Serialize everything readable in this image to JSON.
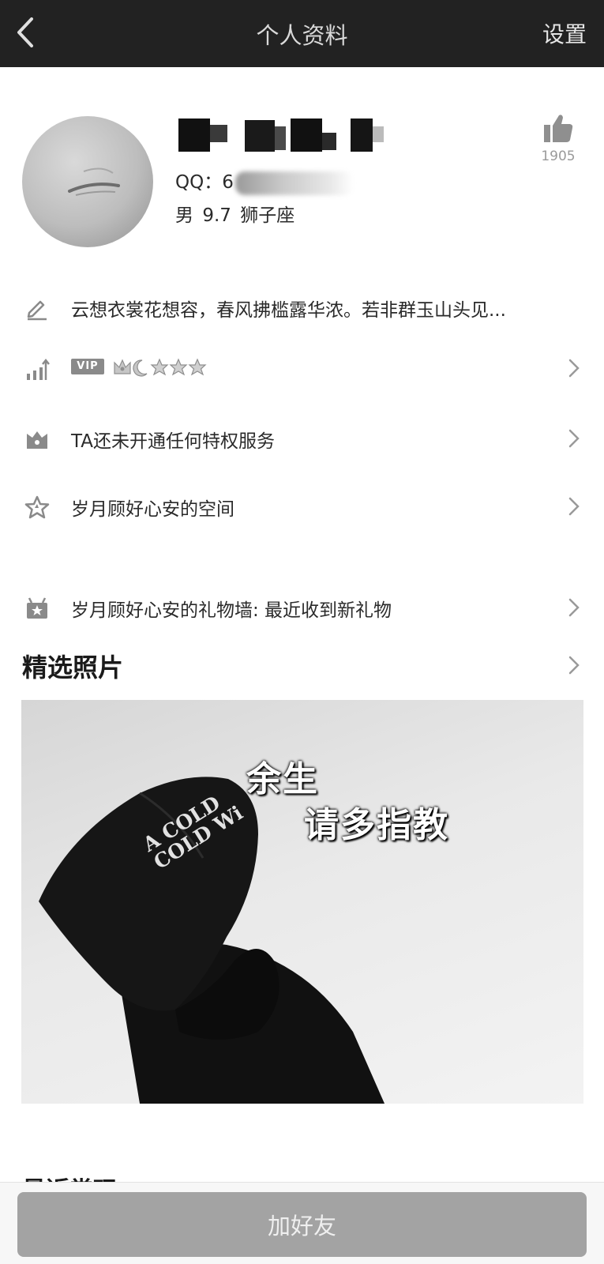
{
  "header": {
    "back_icon": "chevron-left-icon",
    "title": "个人资料",
    "settings_label": "设置"
  },
  "profile": {
    "qq_label": "QQ：6",
    "gender": "男",
    "age": "9.7",
    "zodiac": "狮子座",
    "like_icon": "thumbs-up-icon",
    "like_count": "1905"
  },
  "rows": {
    "signature": {
      "icon": "pencil-icon",
      "text": "云想衣裳花想容，春风拂槛露华浓。若非群玉山头见..."
    },
    "vip": {
      "icon": "level-chart-icon",
      "badge": "VIP",
      "level_icons": [
        "crown-icon",
        "moon-icon",
        "star-icon",
        "star-icon",
        "star-icon"
      ]
    },
    "privilege": {
      "icon": "crown-box-icon",
      "text": "TA还未开通任何特权服务"
    },
    "space": {
      "icon": "star-outline-icon",
      "text": "岁月顾好心安的空间"
    },
    "gift_wall": {
      "icon": "gift-icon",
      "text": "岁月顾好心安的礼物墙: 最近收到新礼物"
    }
  },
  "featured": {
    "title": "精选照片",
    "photo_caption_line1": "余生",
    "photo_caption_line2": "请多指教",
    "hood_text_line1": "A COLD",
    "hood_text_line2": "COLD Wi"
  },
  "next_section_title": "最近常玩",
  "bottom": {
    "add_friend_label": "加好友"
  },
  "colors": {
    "header_bg": "#222222",
    "button_bg": "#a3a3a3",
    "muted_text": "#9a9a9a"
  }
}
